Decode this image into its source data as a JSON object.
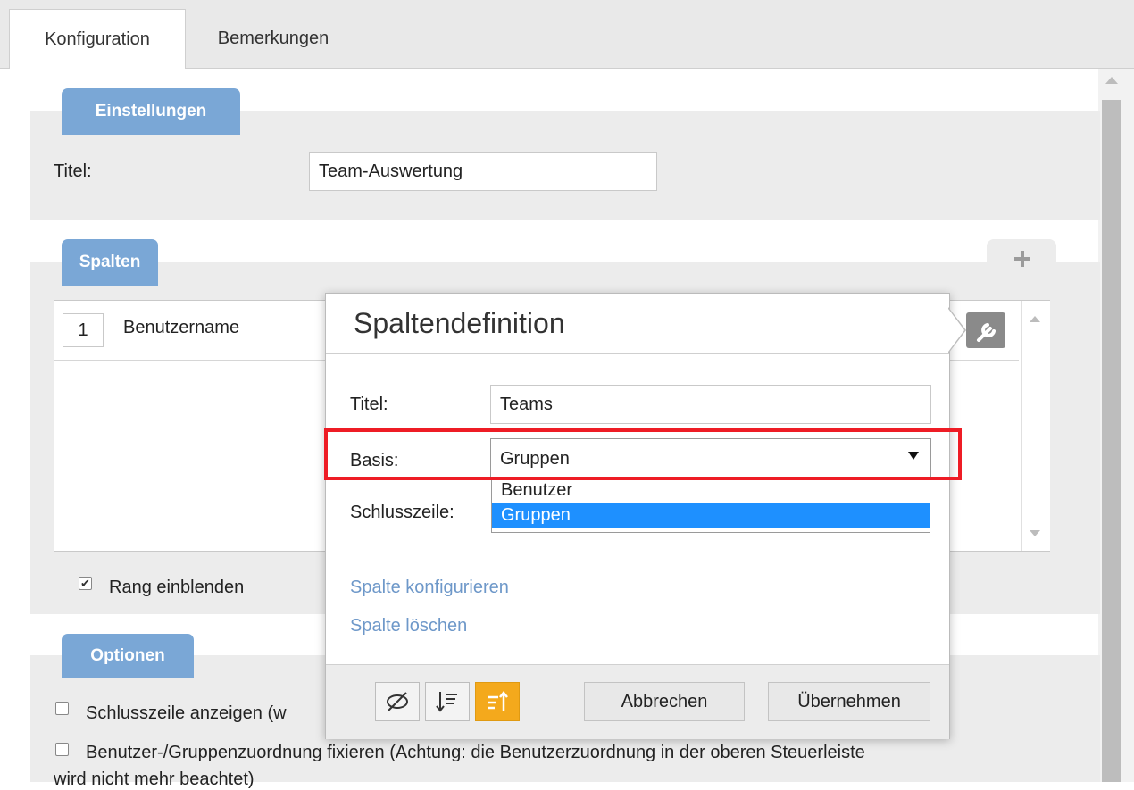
{
  "tabs": [
    {
      "label": "Konfiguration",
      "active": true
    },
    {
      "label": "Bemerkungen",
      "active": false
    }
  ],
  "einstellungen": {
    "section_label": "Einstellungen",
    "title_label": "Titel:",
    "title_value": "Team-Auswertung"
  },
  "spalten": {
    "section_label": "Spalten",
    "add_icon": "plus-icon",
    "rows": [
      {
        "number": "1",
        "name": "Benutzername"
      }
    ],
    "rang_label": "Rang einblenden",
    "rang_checked": true
  },
  "optionen": {
    "section_label": "Optionen",
    "schlusszeile_label": "Schlusszeile anzeigen (w",
    "fixieren_label": "Benutzer-/Gruppenzuordnung fixieren (Achtung: die Benutzerzuordnung in der oberen Steuerleiste",
    "fixieren_label_cont": "wird nicht mehr beachtet)"
  },
  "dialog": {
    "title": "Spaltendefinition",
    "titel_label": "Titel:",
    "titel_value": "Teams",
    "basis_label": "Basis:",
    "basis_value": "Gruppen",
    "basis_options": [
      "Benutzer",
      "Gruppen"
    ],
    "basis_selected_index": 1,
    "schlusszeile_label": "Schlusszeile:",
    "link_configure": "Spalte konfigurieren",
    "link_delete": "Spalte löschen",
    "cancel_label": "Abbrechen",
    "apply_label": "Übernehmen",
    "footer_icons": [
      "eye-hidden-icon",
      "sort-descending-icon",
      "sort-ascending-icon"
    ],
    "active_icon_index": 2
  },
  "colors": {
    "section_tab": "#7aa7d6",
    "link": "#6e98c9",
    "highlight": "#ee1c25",
    "active_icon": "#f4a91c",
    "selected_option": "#1e90ff"
  }
}
